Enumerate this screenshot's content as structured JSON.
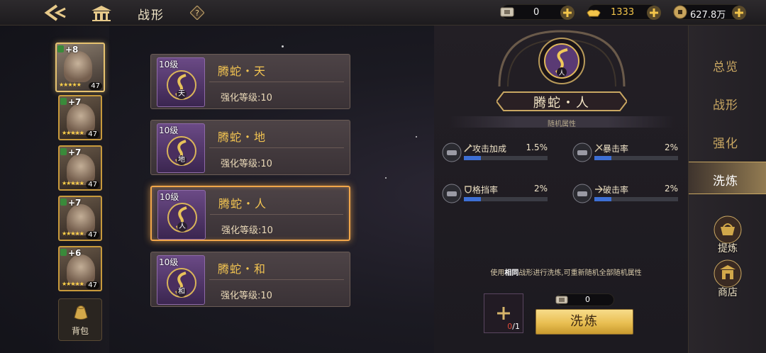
{
  "header": {
    "title": "战形",
    "help_label": "?"
  },
  "resources": [
    {
      "name": "ticket",
      "value": "0",
      "color": "#f2f2f2"
    },
    {
      "name": "gold-ingot",
      "value": "1333",
      "color": "#f3c54a"
    },
    {
      "name": "coin",
      "value": "627.8万",
      "color": "#f2f2f2"
    }
  ],
  "heroes": [
    {
      "plus": "+8",
      "stars": "★★★★★",
      "level": "47",
      "selected": true
    },
    {
      "plus": "+7",
      "stars": "★★★★★",
      "level": "47"
    },
    {
      "plus": "+7",
      "stars": "★★★★★",
      "level": "47"
    },
    {
      "plus": "+7",
      "stars": "★★★★★",
      "level": "47"
    },
    {
      "plus": "+6",
      "stars": "★★★★★",
      "level": "47"
    }
  ],
  "bag": {
    "label": "背包"
  },
  "formations": [
    {
      "level": "10级",
      "name": "腾蛇・天",
      "char": "天",
      "enhance": "强化等级:10"
    },
    {
      "level": "10级",
      "name": "腾蛇・地",
      "char": "地",
      "enhance": "强化等级:10"
    },
    {
      "level": "10级",
      "name": "腾蛇・人",
      "char": "人",
      "enhance": "强化等级:10",
      "selected": true
    },
    {
      "level": "10级",
      "name": "腾蛇・和",
      "char": "和",
      "enhance": "强化等级:10"
    }
  ],
  "detail": {
    "name": "腾蛇・人",
    "medal_char": "人",
    "section_title": "随机属性",
    "attributes": [
      {
        "name": "攻击加成",
        "value": "1.5%",
        "fill": 0.2
      },
      {
        "name": "暴击率",
        "value": "2%",
        "fill": 0.2
      },
      {
        "name": "格挡率",
        "value": "2%",
        "fill": 0.2
      },
      {
        "name": "破击率",
        "value": "2%",
        "fill": 0.2
      }
    ],
    "hint_pre": "使用",
    "hint_bold": "相同",
    "hint_post": "战形进行洗炼,可重新随机全部随机属性",
    "slot_have": "0",
    "slot_need": "/1",
    "cost_value": "0",
    "refine_label": "洗炼"
  },
  "tabs": [
    {
      "label": "总览"
    },
    {
      "label": "战形"
    },
    {
      "label": "强化"
    },
    {
      "label": "洗炼",
      "active": true
    }
  ],
  "side_buttons": [
    {
      "label": "提炼"
    },
    {
      "label": "商店"
    }
  ],
  "colors": {
    "accent_gold": "#f3c451",
    "selected_border": "#f1a64a",
    "bar_fill": "#3d6fd4"
  }
}
